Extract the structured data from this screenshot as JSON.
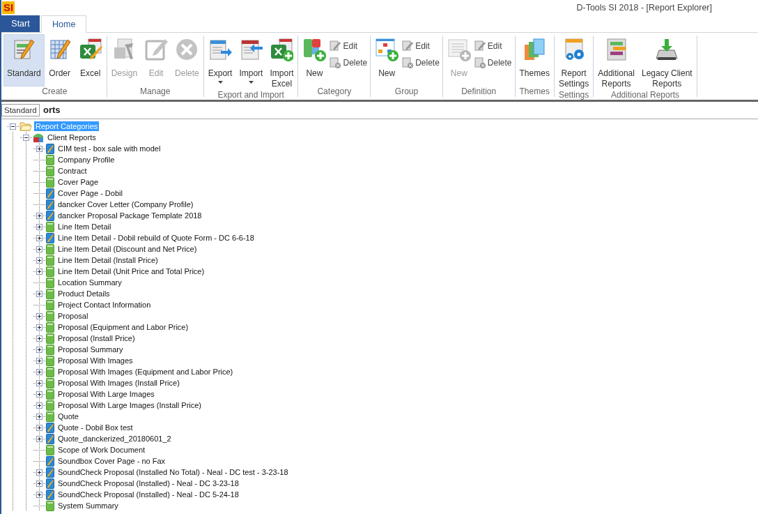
{
  "window": {
    "logo": "SI",
    "title": "D-Tools SI 2018 - [Report Explorer]"
  },
  "tabs": [
    {
      "label": "Start",
      "kind": "app",
      "selected": false
    },
    {
      "label": "Home",
      "kind": "tab",
      "selected": true
    }
  ],
  "ribbon": {
    "groups": [
      {
        "label": "Create",
        "buttons": [
          {
            "kind": "large",
            "lines": [
              "Standard"
            ],
            "highlighted": true,
            "disabled": false
          },
          {
            "kind": "large",
            "lines": [
              "Order"
            ],
            "highlighted": false,
            "disabled": false
          },
          {
            "kind": "large",
            "lines": [
              "Excel"
            ],
            "highlighted": false,
            "disabled": false
          }
        ]
      },
      {
        "label": "Manage",
        "buttons": [
          {
            "kind": "large",
            "lines": [
              "Design"
            ],
            "highlighted": false,
            "disabled": true
          },
          {
            "kind": "large",
            "lines": [
              "Edit"
            ],
            "highlighted": false,
            "disabled": true
          },
          {
            "kind": "large",
            "lines": [
              "Delete"
            ],
            "highlighted": false,
            "disabled": true
          }
        ]
      },
      {
        "label": "Export and Import",
        "buttons": [
          {
            "kind": "large",
            "lines": [
              "Export"
            ],
            "dropdown": true,
            "highlighted": false,
            "disabled": false
          },
          {
            "kind": "large",
            "lines": [
              "Import"
            ],
            "dropdown": true,
            "highlighted": false,
            "disabled": false
          },
          {
            "kind": "large",
            "lines": [
              "Import",
              "Excel"
            ],
            "highlighted": false,
            "disabled": false
          }
        ]
      },
      {
        "label": "Category",
        "buttons": [
          {
            "kind": "large",
            "lines": [
              "New"
            ],
            "highlighted": false,
            "disabled": false
          },
          {
            "kind": "small",
            "lines": [
              "Edit"
            ],
            "highlighted": false,
            "disabled": false
          },
          {
            "kind": "small",
            "lines": [
              "Delete"
            ],
            "highlighted": false,
            "disabled": false
          }
        ]
      },
      {
        "label": "Group",
        "buttons": [
          {
            "kind": "large",
            "lines": [
              "New"
            ],
            "highlighted": false,
            "disabled": false
          },
          {
            "kind": "small",
            "lines": [
              "Edit"
            ],
            "highlighted": false,
            "disabled": false
          },
          {
            "kind": "small",
            "lines": [
              "Delete"
            ],
            "highlighted": false,
            "disabled": false
          }
        ]
      },
      {
        "label": "Definition",
        "buttons": [
          {
            "kind": "large",
            "lines": [
              "New"
            ],
            "highlighted": false,
            "disabled": true
          },
          {
            "kind": "small",
            "lines": [
              "Edit"
            ],
            "highlighted": false,
            "disabled": false
          },
          {
            "kind": "small",
            "lines": [
              "Delete"
            ],
            "highlighted": false,
            "disabled": false
          }
        ]
      },
      {
        "label": "Themes",
        "buttons": [
          {
            "kind": "large",
            "lines": [
              "Themes"
            ],
            "highlighted": false,
            "disabled": false
          }
        ]
      },
      {
        "label": "Settings",
        "buttons": [
          {
            "kind": "large",
            "lines": [
              "Report",
              "Settings"
            ],
            "highlighted": false,
            "disabled": false
          }
        ]
      },
      {
        "label": "Additional Reports",
        "buttons": [
          {
            "kind": "large",
            "lines": [
              "Additional",
              "Reports"
            ],
            "highlighted": false,
            "disabled": false
          },
          {
            "kind": "large",
            "lines": [
              "Legacy Client",
              "Reports"
            ],
            "highlighted": false,
            "disabled": false
          }
        ]
      }
    ]
  },
  "tooltip": "Standard",
  "panel": {
    "title": "orts"
  },
  "tree": {
    "label": "Report Categories",
    "kind": "folder",
    "selected": true,
    "expanded": true,
    "children": [
      {
        "label": "Client Reports",
        "kind": "group",
        "selected": false,
        "expanded": true,
        "children": [
          {
            "label": "CIM test - box sale with model",
            "kind": "custom",
            "expandable": true,
            "selected": false
          },
          {
            "label": "Company Profile",
            "kind": "standard",
            "expandable": false,
            "selected": false
          },
          {
            "label": "Contract",
            "kind": "standard",
            "expandable": false,
            "selected": false
          },
          {
            "label": "Cover Page",
            "kind": "standard",
            "expandable": false,
            "selected": false
          },
          {
            "label": "Cover Page - Dobil",
            "kind": "custom",
            "expandable": false,
            "selected": false
          },
          {
            "label": "dancker Cover Letter (Company Profile)",
            "kind": "custom",
            "expandable": false,
            "selected": false
          },
          {
            "label": "dancker Proposal Package Template 2018",
            "kind": "custom",
            "expandable": true,
            "selected": false
          },
          {
            "label": "Line Item Detail",
            "kind": "standard",
            "expandable": true,
            "selected": false
          },
          {
            "label": "Line Item Detail - Dobil rebuild of Quote Form - DC 6-6-18",
            "kind": "custom",
            "expandable": true,
            "selected": false
          },
          {
            "label": "Line Item Detail (Discount and Net Price)",
            "kind": "standard",
            "expandable": true,
            "selected": false
          },
          {
            "label": "Line Item Detail (Install Price)",
            "kind": "standard",
            "expandable": true,
            "selected": false
          },
          {
            "label": "Line Item Detail (Unit Price and Total Price)",
            "kind": "standard",
            "expandable": true,
            "selected": false
          },
          {
            "label": "Location Summary",
            "kind": "standard",
            "expandable": false,
            "selected": false
          },
          {
            "label": "Product Details",
            "kind": "standard",
            "expandable": true,
            "selected": false
          },
          {
            "label": "Project Contact Information",
            "kind": "standard",
            "expandable": false,
            "selected": false
          },
          {
            "label": "Proposal",
            "kind": "standard",
            "expandable": true,
            "selected": false
          },
          {
            "label": "Proposal (Equipment and Labor Price)",
            "kind": "standard",
            "expandable": true,
            "selected": false
          },
          {
            "label": "Proposal (Install Price)",
            "kind": "standard",
            "expandable": true,
            "selected": false
          },
          {
            "label": "Proposal Summary",
            "kind": "standard",
            "expandable": true,
            "selected": false
          },
          {
            "label": "Proposal With Images",
            "kind": "standard",
            "expandable": true,
            "selected": false
          },
          {
            "label": "Proposal With Images (Equipment and Labor Price)",
            "kind": "standard",
            "expandable": true,
            "selected": false
          },
          {
            "label": "Proposal With Images (Install Price)",
            "kind": "standard",
            "expandable": true,
            "selected": false
          },
          {
            "label": "Proposal With Large Images",
            "kind": "standard",
            "expandable": true,
            "selected": false
          },
          {
            "label": "Proposal With Large Images (Install Price)",
            "kind": "standard",
            "expandable": true,
            "selected": false
          },
          {
            "label": "Quote",
            "kind": "standard",
            "expandable": true,
            "selected": false
          },
          {
            "label": "Quote - Dobil Box test",
            "kind": "custom",
            "expandable": true,
            "selected": false
          },
          {
            "label": "Quote_danckerized_20180601_2",
            "kind": "custom",
            "expandable": true,
            "selected": false
          },
          {
            "label": "Scope of Work Document",
            "kind": "standard",
            "expandable": false,
            "selected": false
          },
          {
            "label": "Soundbox Cover Page - no Fax",
            "kind": "custom",
            "expandable": false,
            "selected": false
          },
          {
            "label": "SoundCheck Proposal (Installed No Total) - Neal - DC test - 3-23-18",
            "kind": "custom",
            "expandable": true,
            "selected": false
          },
          {
            "label": "SoundCheck Proposal (Installed) - Neal - DC 3-23-18",
            "kind": "custom",
            "expandable": true,
            "selected": false
          },
          {
            "label": "SoundCheck Proposal (Installed) - Neal - DC 5-24-18",
            "kind": "custom",
            "expandable": true,
            "selected": false
          },
          {
            "label": "System Summary",
            "kind": "standard",
            "expandable": false,
            "selected": false
          }
        ]
      }
    ]
  }
}
